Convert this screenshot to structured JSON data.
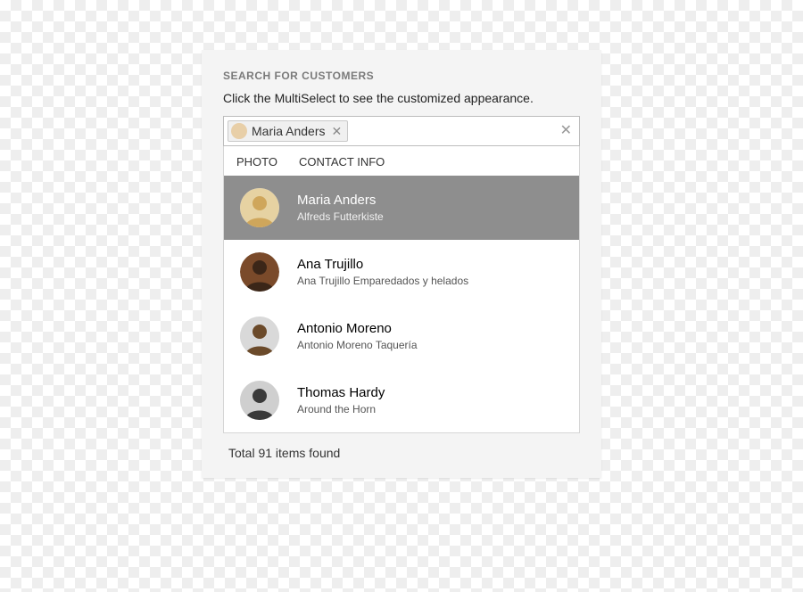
{
  "heading": "SEARCH FOR CUSTOMERS",
  "instructions": "Click the MultiSelect to see the customized appearance.",
  "multiselect": {
    "chip": {
      "label": "Maria Anders"
    }
  },
  "dropdown": {
    "header": {
      "photo": "PHOTO",
      "contact": "CONTACT INFO"
    },
    "items": [
      {
        "name": "Maria Anders",
        "company": "Alfreds Futterkiste",
        "selected": true,
        "avatar_bg": "#e6d2a2",
        "avatar_fg": "#cfa65b"
      },
      {
        "name": "Ana Trujillo",
        "company": "Ana Trujillo Emparedados y helados",
        "selected": false,
        "avatar_bg": "#7a4a2a",
        "avatar_fg": "#3b2618"
      },
      {
        "name": "Antonio Moreno",
        "company": "Antonio Moreno Taquería",
        "selected": false,
        "avatar_bg": "#d9d9d9",
        "avatar_fg": "#6b4a2a"
      },
      {
        "name": "Thomas Hardy",
        "company": "Around the Horn",
        "selected": false,
        "avatar_bg": "#cfcfcf",
        "avatar_fg": "#3a3a3a"
      }
    ]
  },
  "footer": {
    "total_text": "Total 91 items found",
    "total_count": 91
  }
}
